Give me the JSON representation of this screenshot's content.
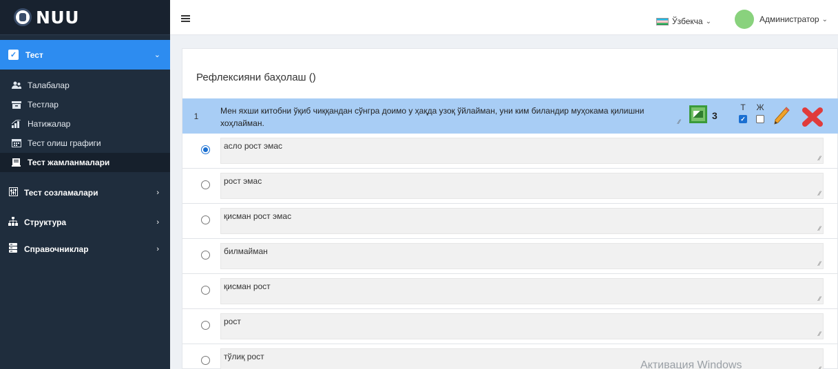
{
  "brand": {
    "name": "NUU"
  },
  "sidebar": {
    "active_menu": "Тест",
    "subitems": [
      {
        "label": "Талабалар",
        "icon": "users-icon"
      },
      {
        "label": "Тестлар",
        "icon": "inbox-icon"
      },
      {
        "label": "Натижалар",
        "icon": "chart-icon"
      },
      {
        "label": "Тест олиш графиги",
        "icon": "calendar-icon"
      },
      {
        "label": "Тест жамланмалари",
        "icon": "book-icon"
      }
    ],
    "groups": [
      {
        "label": "Тест созламалари",
        "icon": "sliders-icon"
      },
      {
        "label": "Структура",
        "icon": "sitemap-icon"
      },
      {
        "label": "Справочниклар",
        "icon": "database-icon"
      }
    ]
  },
  "header": {
    "language": "Ўзбекча",
    "user": "Администратор"
  },
  "content": {
    "title": "Рефлексияни баҳолаш ()",
    "question": {
      "number": "1",
      "text": "Мен яхши китобни ўқиб чиққандан сўнгра доимо у ҳақда узоқ ўйлайман, уни ким биландир муҳокама қилишни хоҳлайман.",
      "score": "3",
      "flag_t_label": "Т",
      "flag_zh_label": "Ж"
    },
    "answers": [
      "асло рост эмас",
      "рост эмас",
      "қисман рост эмас",
      "билмайман",
      "қисман рост",
      "рост",
      "тўлиқ рост"
    ]
  },
  "watermark": "Активация Windows"
}
